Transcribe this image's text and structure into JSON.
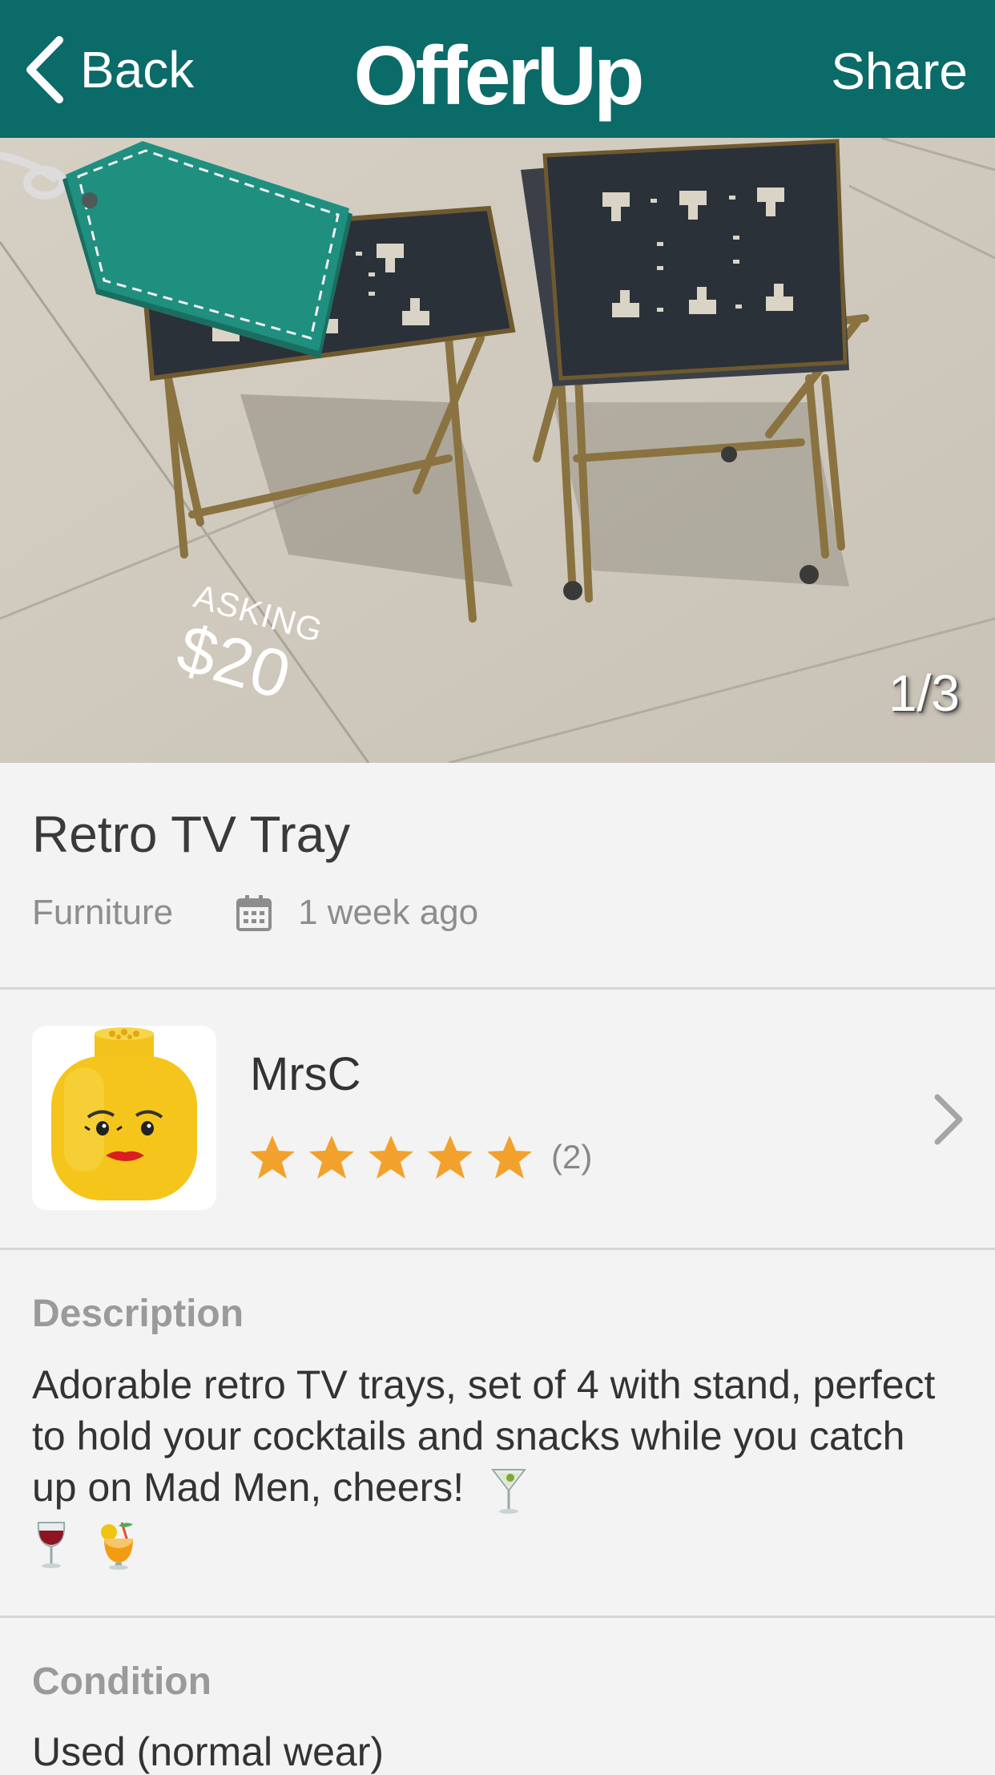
{
  "nav": {
    "back_label": "Back",
    "logo": "OfferUp",
    "share_label": "Share"
  },
  "photo": {
    "counter": "1/3",
    "tag_asking": "ASKING",
    "tag_price": "$20"
  },
  "item": {
    "title": "Retro TV Tray",
    "category": "Furniture",
    "posted": "1 week ago"
  },
  "seller": {
    "name": "MrsC",
    "rating": 5,
    "rating_max": 5,
    "rating_count": "(2)"
  },
  "description": {
    "label": "Description",
    "text": "Adorable retro TV trays, set of 4 with stand, perfect to hold your cocktails and snacks while you catch up on Mad Men, cheers!",
    "emojis": [
      "cocktail-glass",
      "wine-glass",
      "tropical-drink"
    ]
  },
  "condition": {
    "label": "Condition",
    "value": "Used (normal wear)"
  },
  "colors": {
    "brand": "#0a6b69",
    "tag": "#1f8f7f",
    "star": "#f2a22c"
  }
}
